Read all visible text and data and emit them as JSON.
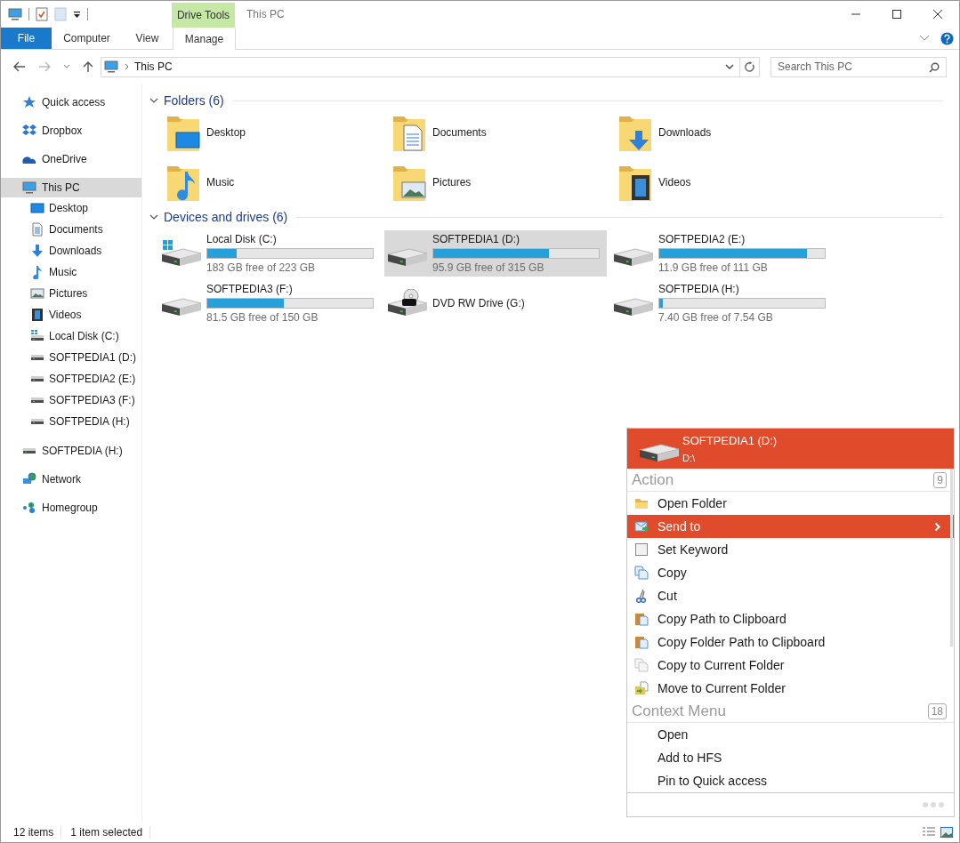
{
  "window": {
    "title": "This PC",
    "contextual_tab": "Drive Tools"
  },
  "ribbon_tabs": [
    {
      "label": "File",
      "kind": "file"
    },
    {
      "label": "Computer",
      "kind": "tab"
    },
    {
      "label": "View",
      "kind": "tab"
    },
    {
      "label": "Manage",
      "kind": "contextual"
    }
  ],
  "address_bar": {
    "path": "This PC"
  },
  "search": {
    "placeholder": "Search This PC"
  },
  "sidebar": {
    "items": [
      {
        "label": "Quick access",
        "kind": "star",
        "selected": false
      },
      {
        "label": "Dropbox",
        "kind": "dropbox",
        "selected": false
      },
      {
        "label": "OneDrive",
        "kind": "cloud",
        "selected": false
      },
      {
        "label": "This PC",
        "kind": "pc",
        "selected": true,
        "children": [
          {
            "label": "Desktop",
            "kind": "desktop",
            "selected": false
          },
          {
            "label": "Documents",
            "kind": "document",
            "selected": false
          },
          {
            "label": "Downloads",
            "kind": "download",
            "selected": false
          },
          {
            "label": "Music",
            "kind": "music",
            "selected": false
          },
          {
            "label": "Pictures",
            "kind": "picture",
            "selected": false
          },
          {
            "label": "Videos",
            "kind": "video",
            "selected": false
          },
          {
            "label": "Local Disk (C:)",
            "kind": "windisk",
            "selected": false
          },
          {
            "label": "SOFTPEDIA1 (D:)",
            "kind": "disk",
            "selected": false
          },
          {
            "label": "SOFTPEDIA2 (E:)",
            "kind": "disk",
            "selected": false
          },
          {
            "label": "SOFTPEDIA3 (F:)",
            "kind": "disk",
            "selected": false
          },
          {
            "label": "SOFTPEDIA (H:)",
            "kind": "disk",
            "selected": false
          }
        ]
      },
      {
        "label": "SOFTPEDIA (H:)",
        "kind": "disk",
        "selected": false
      },
      {
        "label": "Network",
        "kind": "network",
        "selected": false
      },
      {
        "label": "Homegroup",
        "kind": "homegroup",
        "selected": false
      }
    ]
  },
  "folders": {
    "title": "Folders (6)",
    "items": [
      {
        "name": "Desktop",
        "kind": "desktop"
      },
      {
        "name": "Documents",
        "kind": "document"
      },
      {
        "name": "Downloads",
        "kind": "download"
      },
      {
        "name": "Music",
        "kind": "music"
      },
      {
        "name": "Pictures",
        "kind": "picture"
      },
      {
        "name": "Videos",
        "kind": "video"
      }
    ]
  },
  "drives": {
    "title": "Devices and drives (6)",
    "items": [
      {
        "name": "Local Disk (C:)",
        "kind": "windisk",
        "free": "183 GB free of 223 GB",
        "level": 0.18,
        "selected": false
      },
      {
        "name": "SOFTPEDIA1 (D:)",
        "kind": "disk",
        "free": "95.9 GB free of 315 GB",
        "level": 0.7,
        "selected": true
      },
      {
        "name": "SOFTPEDIA2 (E:)",
        "kind": "disk",
        "free": "11.9 GB free of 111 GB",
        "level": 0.89,
        "selected": false
      },
      {
        "name": "SOFTPEDIA3 (F:)",
        "kind": "disk",
        "free": "81.5 GB free of 150 GB",
        "level": 0.46,
        "selected": false
      },
      {
        "name": "DVD RW Drive (G:)",
        "kind": "dvd",
        "selected": false
      },
      {
        "name": "SOFTPEDIA (H:)",
        "kind": "disk",
        "free": "7.40 GB free of 7.54 GB",
        "level": 0.02,
        "selected": false
      }
    ]
  },
  "popup": {
    "title": "SOFTPEDIA1 (D:)",
    "path": "D:\\",
    "sections": [
      {
        "title": "Action",
        "count": "9",
        "items": [
          {
            "label": "Open Folder",
            "kind": "folder",
            "selected": false,
            "submenu": false
          },
          {
            "label": "Send to",
            "kind": "send",
            "selected": true,
            "submenu": true
          },
          {
            "label": "Set Keyword",
            "kind": "key",
            "selected": false,
            "submenu": false
          },
          {
            "label": "Copy",
            "kind": "copy",
            "selected": false,
            "submenu": false
          },
          {
            "label": "Cut",
            "kind": "cut",
            "selected": false,
            "submenu": false
          },
          {
            "label": "Copy Path to Clipboard",
            "kind": "clipboard",
            "selected": false,
            "submenu": false
          },
          {
            "label": "Copy Folder Path to Clipboard",
            "kind": "clipboard",
            "selected": false,
            "submenu": false
          },
          {
            "label": "Copy to Current Folder",
            "kind": "copyfaded",
            "selected": false,
            "submenu": false
          },
          {
            "label": "Move to Current Folder",
            "kind": "move",
            "selected": false,
            "submenu": false
          }
        ]
      },
      {
        "title": "Context Menu",
        "count": "18",
        "items": [
          {
            "label": "Open",
            "kind": "none",
            "selected": false,
            "submenu": false
          },
          {
            "label": "Add to HFS",
            "kind": "none",
            "selected": false,
            "submenu": false
          },
          {
            "label": "Pin to Quick access",
            "kind": "none",
            "selected": false,
            "submenu": false
          }
        ]
      }
    ]
  },
  "status_bar": {
    "count": "12 items",
    "selection": "1 item selected"
  }
}
